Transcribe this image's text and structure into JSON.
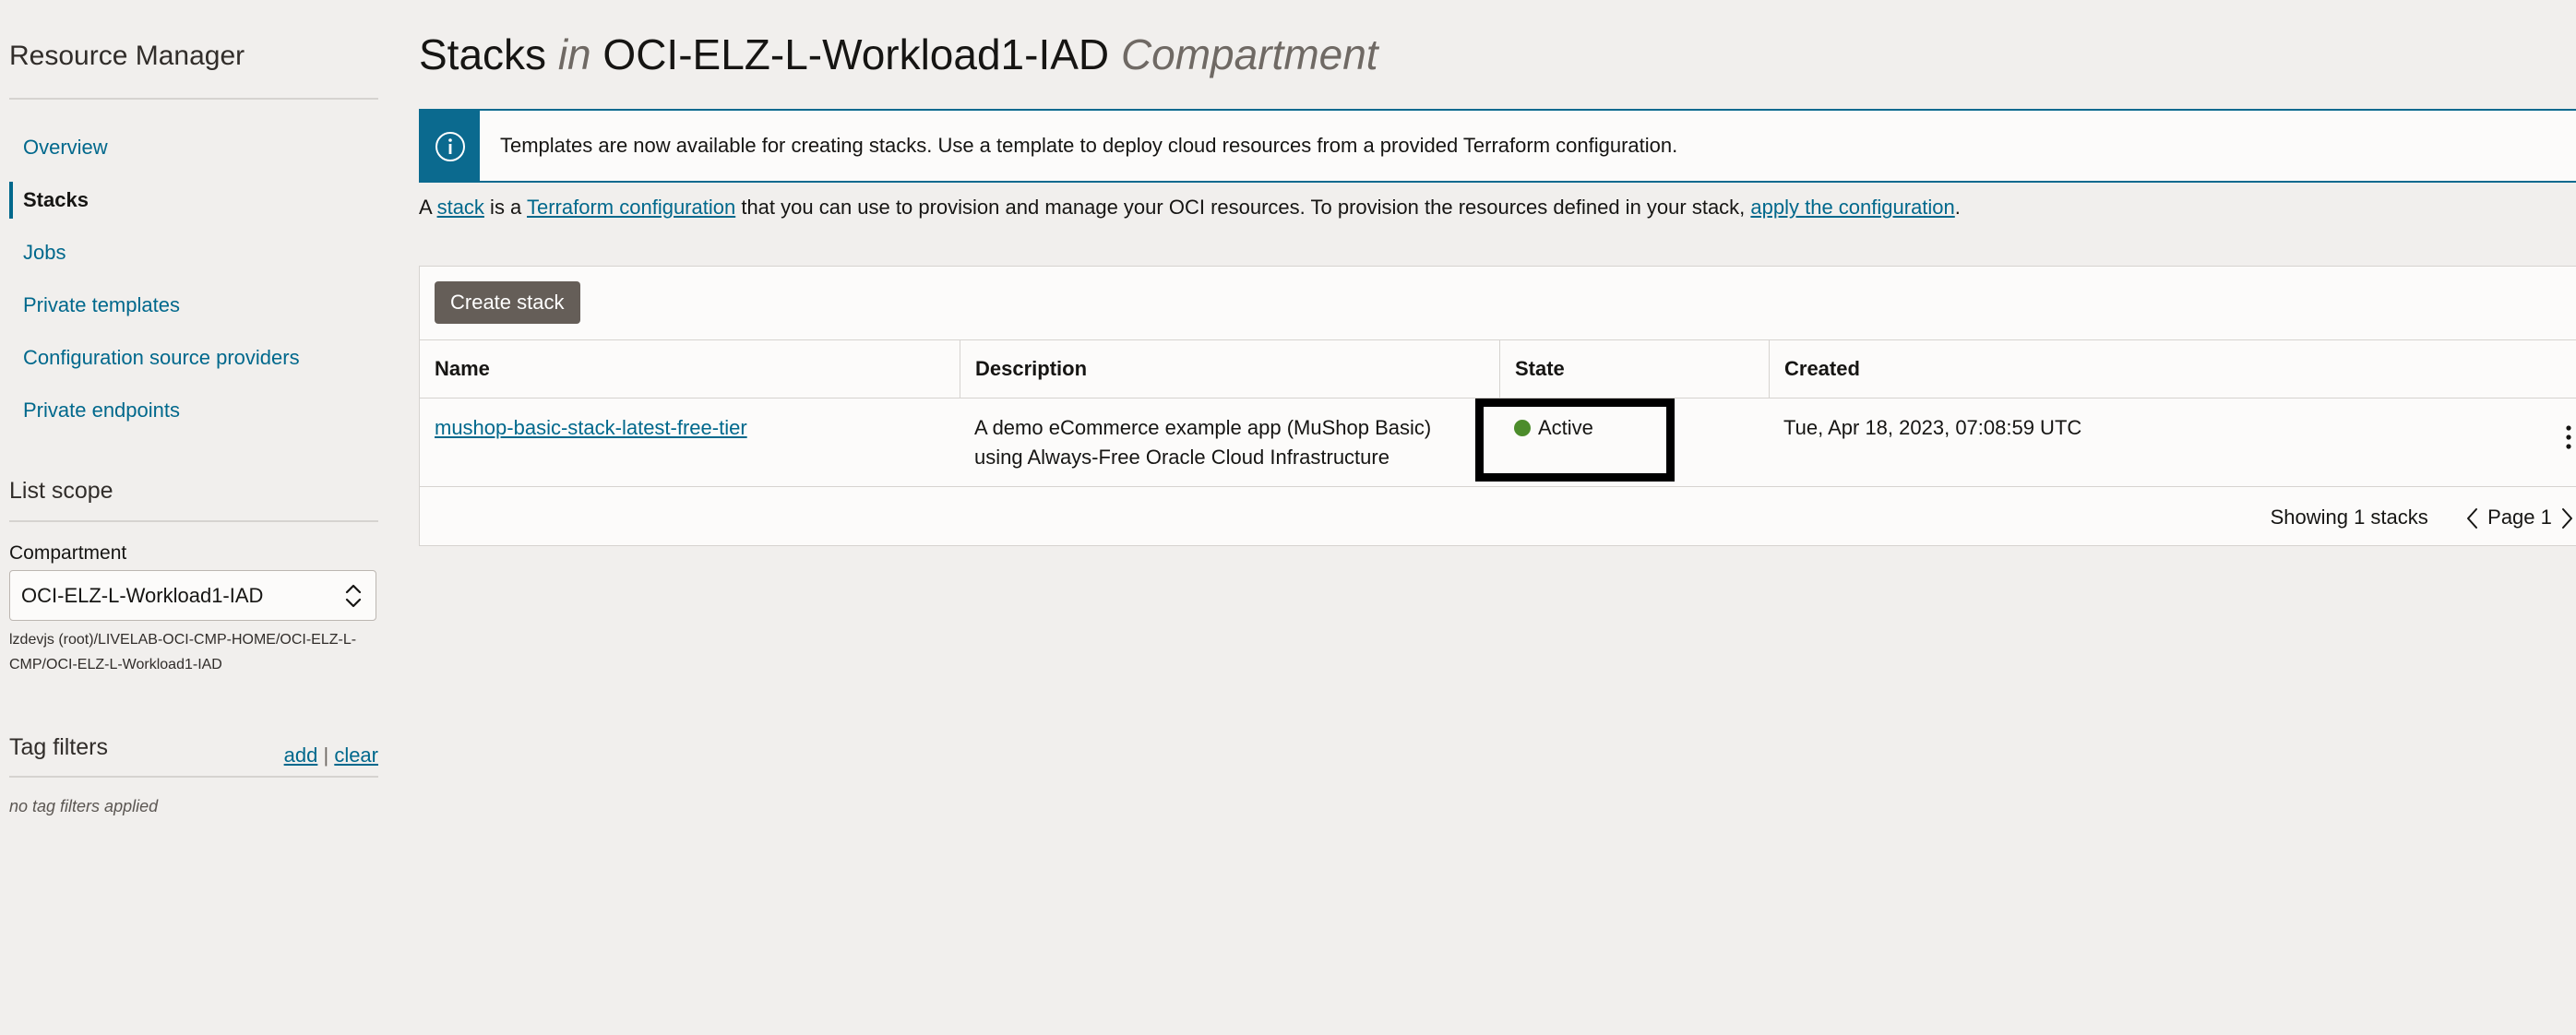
{
  "sidebar": {
    "title": "Resource Manager",
    "nav": [
      {
        "label": "Overview",
        "active": false
      },
      {
        "label": "Stacks",
        "active": true
      },
      {
        "label": "Jobs",
        "active": false
      },
      {
        "label": "Private templates",
        "active": false
      },
      {
        "label": "Configuration source providers",
        "active": false
      },
      {
        "label": "Private endpoints",
        "active": false
      }
    ],
    "list_scope": {
      "title": "List scope",
      "compartment_label": "Compartment",
      "compartment_value": "OCI-ELZ-L-Workload1-IAD",
      "compartment_path": "lzdevjs (root)/LIVELAB-OCI-CMP-HOME/OCI-ELZ-L-CMP/OCI-ELZ-L-Workload1-IAD"
    },
    "tag_filters": {
      "title": "Tag filters",
      "add": "add",
      "separator": "|",
      "clear": "clear",
      "empty": "no tag filters applied"
    }
  },
  "main": {
    "title_prefix": "Stacks",
    "title_in": "in",
    "title_compartment": "OCI-ELZ-L-Workload1-IAD",
    "title_suffix": "Compartment",
    "banner": {
      "icon": "info-icon",
      "text": "Templates are now available for creating stacks. Use a template to deploy cloud resources from a provided Terraform configuration."
    },
    "intro": {
      "t1": "A ",
      "link1": "stack",
      "t2": " is a ",
      "link2": "Terraform configuration",
      "t3": " that you can use to provision and manage your OCI resources. To provision the resources defined in your stack, ",
      "link3": "apply the configuration",
      "t4": "."
    },
    "create_button": "Create stack",
    "table": {
      "columns": [
        "Name",
        "Description",
        "State",
        "Created"
      ],
      "rows": [
        {
          "name": "mushop-basic-stack-latest-free-tier",
          "description_line1": "A demo eCommerce example app (MuShop Basic)",
          "description_line2": "using Always-Free Oracle Cloud Infrastructure",
          "state": "Active",
          "created": "Tue, Apr 18, 2023, 07:08:59 UTC"
        }
      ]
    },
    "footer": {
      "showing": "Showing 1 stacks",
      "page": "Page 1"
    }
  },
  "colors": {
    "link": "#00688c",
    "banner_accent": "#0b6a8f",
    "state_active": "#4c8c2b",
    "button_bg": "#655e58",
    "background": "#f1efed"
  }
}
